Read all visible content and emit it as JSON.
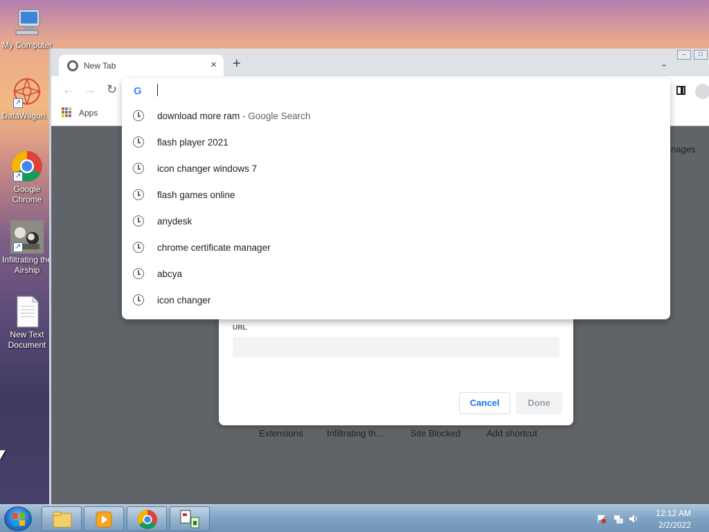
{
  "desktop": {
    "icons": [
      {
        "label": "My Computer",
        "icon": "computer-icon"
      },
      {
        "label": "DataWagon...",
        "icon": "datawagon-icon"
      },
      {
        "label": "Google Chrome",
        "icon": "chrome-icon"
      },
      {
        "label": "Infiltrating the Airship",
        "icon": "game-icon"
      },
      {
        "label": "New Text Document",
        "icon": "text-document-icon"
      }
    ]
  },
  "browser": {
    "tab": {
      "title": "New Tab",
      "close": "×"
    },
    "new_tab": "+",
    "tab_menu": "⌄",
    "bookmarks": {
      "apps_label": "Apps"
    },
    "page": {
      "images_link": "nages"
    },
    "omnibox": {
      "value": "",
      "suggestions": [
        {
          "text": "download more ram",
          "suffix": " - Google Search"
        },
        {
          "text": "flash player 2021",
          "suffix": ""
        },
        {
          "text": "icon changer windows 7",
          "suffix": ""
        },
        {
          "text": "flash games online",
          "suffix": ""
        },
        {
          "text": "anydesk",
          "suffix": ""
        },
        {
          "text": "chrome certificate manager",
          "suffix": ""
        },
        {
          "text": "abcya",
          "suffix": ""
        },
        {
          "text": "icon changer",
          "suffix": ""
        }
      ]
    },
    "shortcut_dialog": {
      "url_label": "URL",
      "url_value": "",
      "cancel_label": "Cancel",
      "done_label": "Done"
    },
    "shortcuts": [
      "Extensions",
      "Infiltrating th...",
      "Site Blocked",
      "Add shortcut"
    ]
  },
  "taskbar": {
    "time": "12:12 AM",
    "date": "2/2/2022"
  },
  "colors": {
    "accent": "#1a73e8",
    "google_blue": "#4285f4",
    "google_red": "#ea4335",
    "google_yellow": "#fbbc05",
    "google_green": "#34a853"
  }
}
